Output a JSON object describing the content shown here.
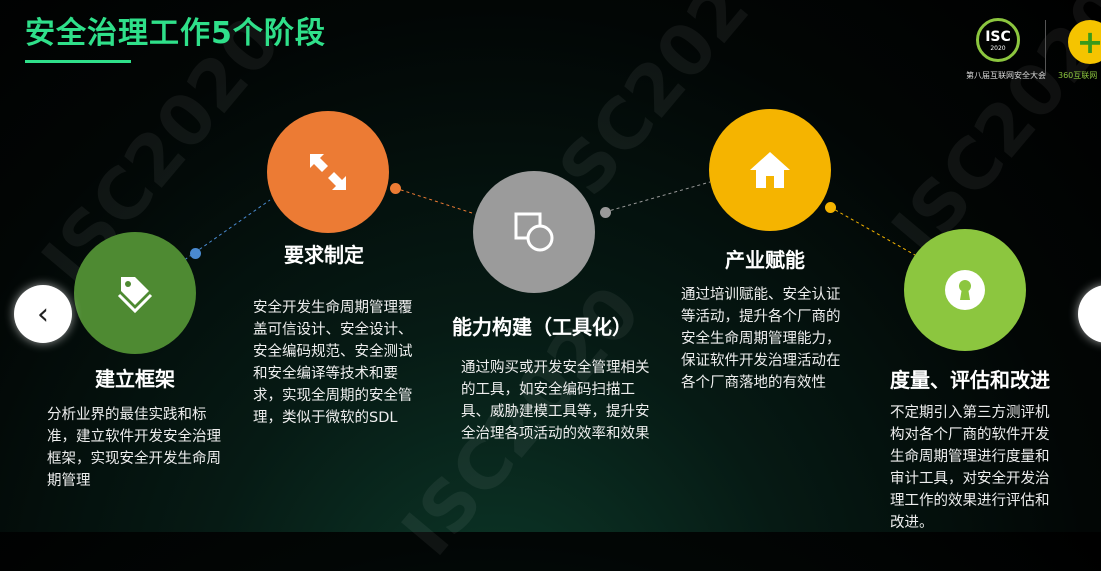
{
  "header": {
    "title": "安全治理工作5个阶段"
  },
  "logo": {
    "isc_text": "ISC",
    "isc_year": "2020",
    "isc_caption": "第八届互联网安全大会",
    "partner_caption": "360互联网"
  },
  "watermark": "ISC2020",
  "nav": {
    "prev": "‹",
    "next": "›"
  },
  "colors": {
    "accent": "#2fe08a",
    "stage1": "#4e8a32",
    "stage2": "#ec7b34",
    "stage3": "#9b9b9b",
    "stage4": "#f5b400",
    "stage5": "#8cc63f"
  },
  "stages": [
    {
      "icon": "tags-icon",
      "title": "建立框架",
      "desc": "分析业界的最佳实践和标准，建立软件开发安全治理框架，实现安全开发生命周期管理"
    },
    {
      "icon": "expand-arrows-icon",
      "title": "要求制定",
      "desc": "安全开发生命周期管理覆盖可信设计、安全设计、安全编码规范、安全测试和安全编译等技术和要求，实现全周期的安全管理，类似于微软的SDL"
    },
    {
      "icon": "shapes-icon",
      "title": "能力构建（工具化）",
      "desc": "通过购买或开发安全管理相关的工具，如安全编码扫描工具、威胁建模工具等，提升安全治理各项活动的效率和效果"
    },
    {
      "icon": "home-icon",
      "title": "产业赋能",
      "desc": "通过培训赋能、安全认证等活动，提升各个厂商的安全生命周期管理能力，保证软件开发治理活动在各个厂商落地的有效性"
    },
    {
      "icon": "keyhole-icon",
      "title": "度量、评估和改进",
      "desc": "不定期引入第三方测评机构对各个厂商的软件开发生命周期管理进行度量和审计工具，对安全开发治理工作的效果进行评估和改进。"
    }
  ]
}
